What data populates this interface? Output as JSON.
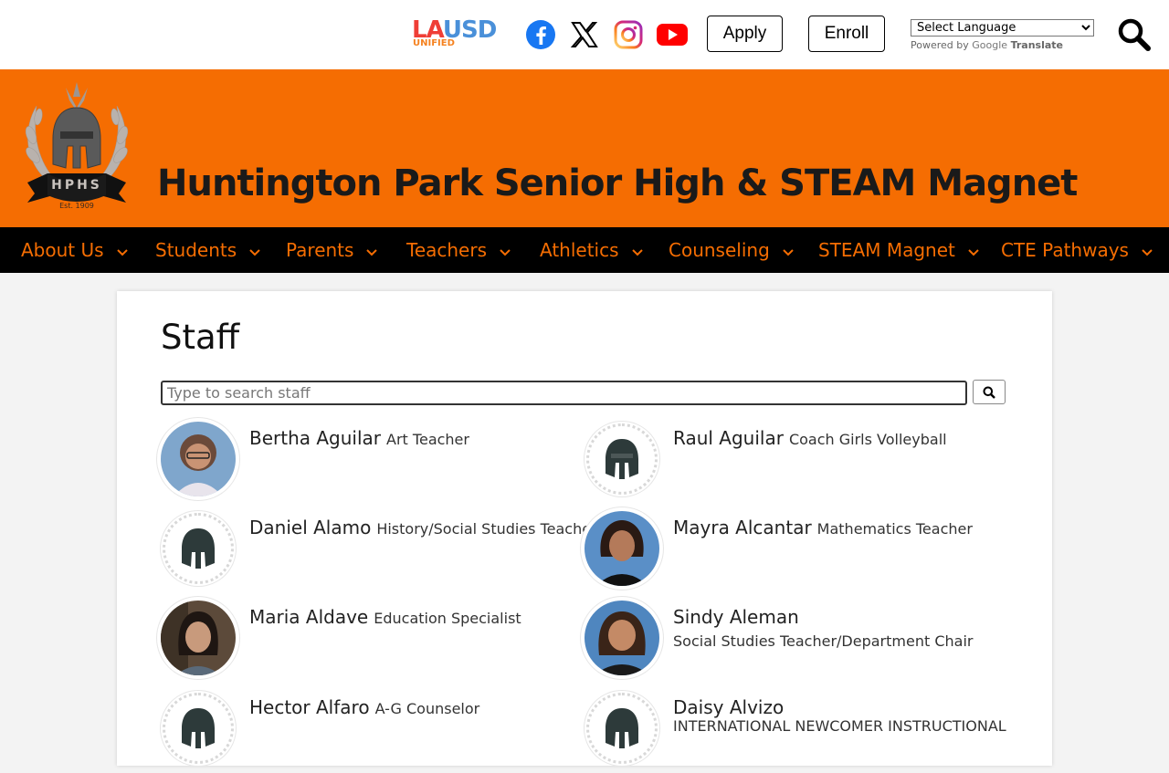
{
  "topbar": {
    "lausd_main_left": "LA",
    "lausd_main_right": "USD",
    "lausd_sub": "UNIFIED",
    "social_icons": [
      "facebook-icon",
      "x-icon",
      "instagram-icon",
      "youtube-icon"
    ],
    "apply_label": "Apply",
    "enroll_label": "Enroll",
    "language_select": "Select Language",
    "powered_by": "Powered by",
    "google": "Google",
    "translate": "Translate"
  },
  "banner": {
    "school_name": "Huntington Park Senior High & STEAM Magnet",
    "logo_text": "HPHS",
    "logo_est": "Est. 1909",
    "color": "#f56d02"
  },
  "nav": {
    "items": [
      "About Us",
      "Students",
      "Parents",
      "Teachers",
      "Athletics",
      "Counseling",
      "STEAM Magnet",
      "CTE Pathways"
    ]
  },
  "staff": {
    "title": "Staff",
    "search_placeholder": "Type to search staff",
    "people": [
      {
        "name": "Bertha Aguilar",
        "role": "Art Teacher",
        "photo": true
      },
      {
        "name": "Raul Aguilar",
        "role": "Coach Girls Volleyball",
        "photo": false
      },
      {
        "name": "Daniel Alamo",
        "role": "History/Social Studies Teacher",
        "photo": false
      },
      {
        "name": "Mayra Alcantar",
        "role": "Mathematics Teacher",
        "photo": true
      },
      {
        "name": "Maria Aldave",
        "role": "Education Specialist",
        "photo": true
      },
      {
        "name": "Sindy Aleman",
        "role": "Social Studies Teacher/Department Chair",
        "photo": true
      },
      {
        "name": "Hector Alfaro",
        "role": "A-G Counselor",
        "photo": false
      },
      {
        "name": "Daisy Alvizo",
        "role": "INTERNATIONAL NEWCOMER INSTRUCTIONAL",
        "photo": false
      }
    ]
  }
}
